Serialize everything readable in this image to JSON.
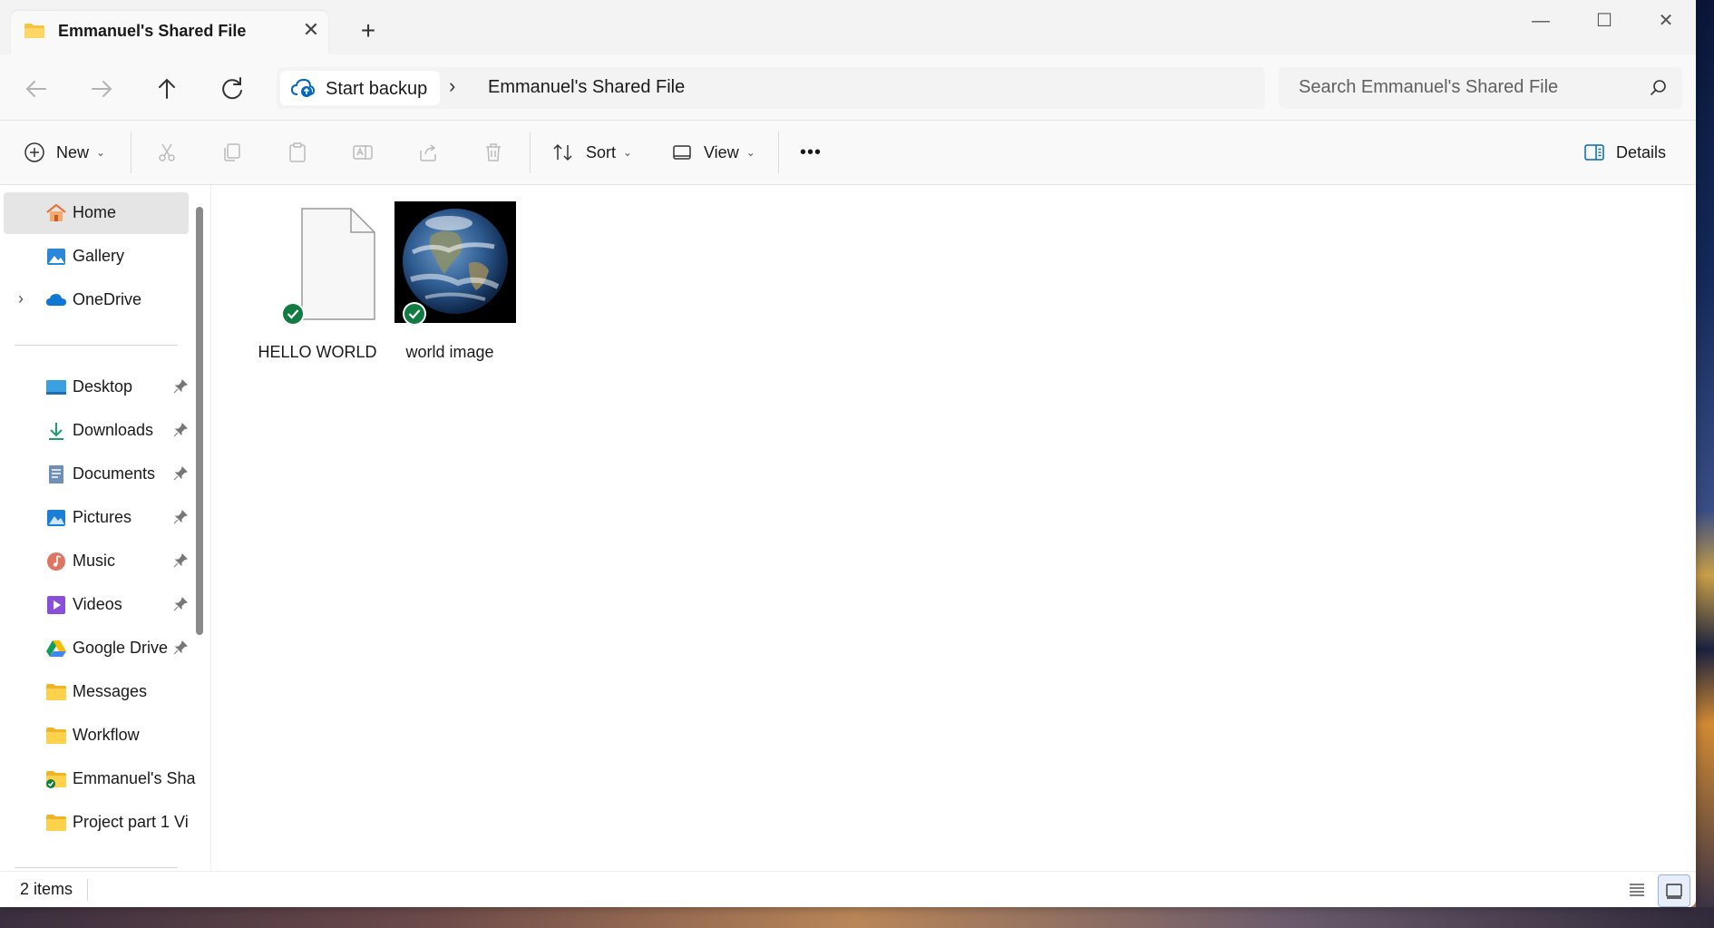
{
  "window": {
    "tab_title": "Emmanuel's Shared File",
    "new_tab_symbol": "+",
    "close_tab_symbol": "✕",
    "minimize_symbol": "—",
    "maximize_symbol": "☐",
    "close_symbol": "✕"
  },
  "nav": {
    "backup_label": "Start backup",
    "breadcrumb": [
      "Emmanuel's Shared File"
    ],
    "search_placeholder": "Search Emmanuel's Shared File"
  },
  "toolbar": {
    "new_label": "New",
    "sort_label": "Sort",
    "view_label": "View",
    "more_label": "•••",
    "details_label": "Details"
  },
  "sidebar": {
    "quick": [
      {
        "label": "Home",
        "icon": "home-icon",
        "selected": true
      },
      {
        "label": "Gallery",
        "icon": "gallery-icon"
      },
      {
        "label": "OneDrive",
        "icon": "onedrive-icon",
        "expandable": true
      }
    ],
    "pinned": [
      {
        "label": "Desktop",
        "icon": "desktop-icon",
        "pinned": true
      },
      {
        "label": "Downloads",
        "icon": "downloads-icon",
        "pinned": true
      },
      {
        "label": "Documents",
        "icon": "documents-icon",
        "pinned": true
      },
      {
        "label": "Pictures",
        "icon": "pictures-icon",
        "pinned": true
      },
      {
        "label": "Music",
        "icon": "music-icon",
        "pinned": true
      },
      {
        "label": "Videos",
        "icon": "videos-icon",
        "pinned": true
      },
      {
        "label": "Google Drive",
        "icon": "google-drive-icon",
        "pinned": true
      },
      {
        "label": "Messages",
        "icon": "folder-icon"
      },
      {
        "label": "Workflow",
        "icon": "folder-icon"
      },
      {
        "label": "Emmanuel's Sha",
        "icon": "shared-folder-icon"
      },
      {
        "label": "Project part 1 Vi",
        "icon": "folder-icon"
      }
    ]
  },
  "files": [
    {
      "name": "HELLO WORLD",
      "type": "document",
      "sync": "synced"
    },
    {
      "name": "world image",
      "type": "image",
      "sync": "synced"
    }
  ],
  "status": {
    "item_count": "2 items"
  },
  "colors": {
    "accent": "#0067c0",
    "folder": "#f5c542",
    "sync_green": "#107c41",
    "selected_bg": "#e5e5e5"
  }
}
